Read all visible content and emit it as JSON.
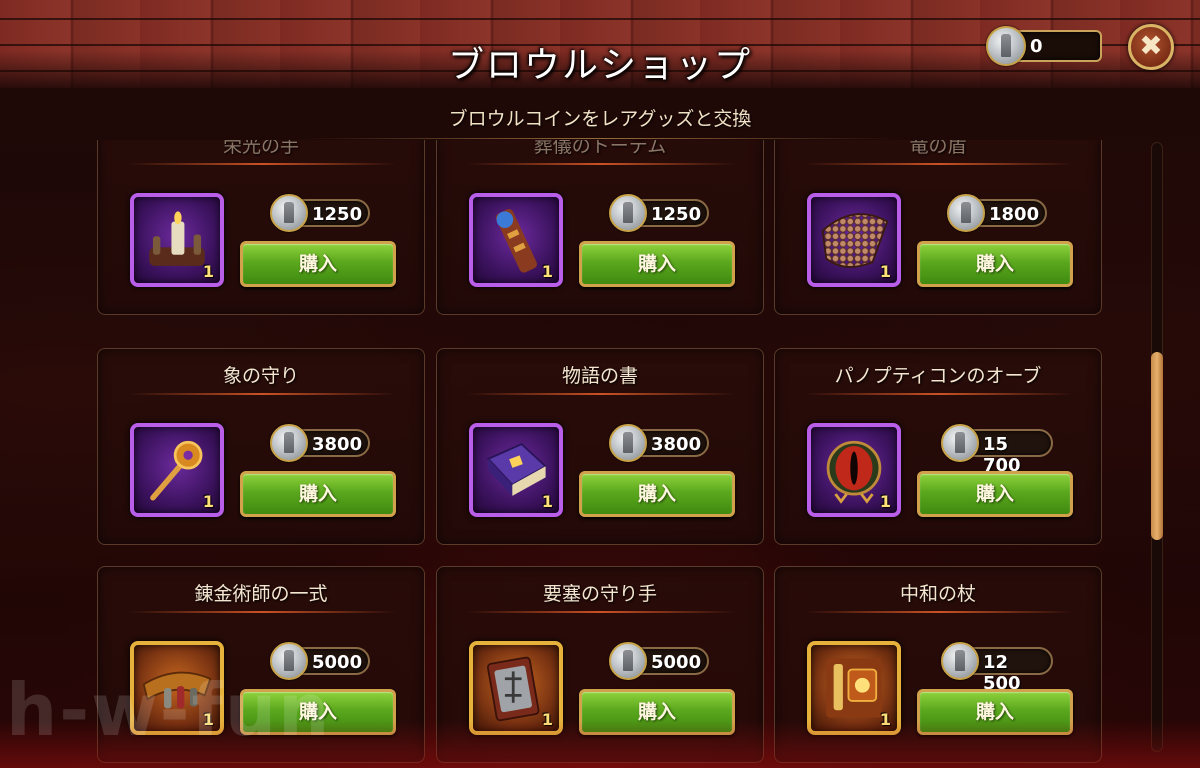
{
  "header": {
    "title": "ブロウルショップ",
    "coins": "0",
    "close_symbol": "✖"
  },
  "subtitle": "ブロウルコインをレアグッズと交換",
  "items": [
    {
      "name": "栄光の手",
      "price": "1250",
      "qty": "1",
      "buy_label": "購入",
      "frame": "purple",
      "icon": "candle-hand-icon"
    },
    {
      "name": "葬儀のトーテム",
      "price": "1250",
      "qty": "1",
      "buy_label": "購入",
      "frame": "purple",
      "icon": "totem-icon"
    },
    {
      "name": "竜の盾",
      "price": "1800",
      "qty": "1",
      "buy_label": "購入",
      "frame": "purple",
      "icon": "dragon-scale-shield-icon"
    },
    {
      "name": "象の守り",
      "price": "3800",
      "qty": "1",
      "buy_label": "購入",
      "frame": "purple",
      "icon": "amulet-icon"
    },
    {
      "name": "物語の書",
      "price": "3800",
      "qty": "1",
      "buy_label": "購入",
      "frame": "purple",
      "icon": "book-icon"
    },
    {
      "name": "パノプティコンのオーブ",
      "price": "15 700",
      "qty": "1",
      "buy_label": "購入",
      "frame": "purple",
      "icon": "eye-orb-icon"
    },
    {
      "name": "錬金術師の一式",
      "price": "5000",
      "qty": "1",
      "buy_label": "購入",
      "frame": "gold",
      "icon": "alchemy-kit-icon"
    },
    {
      "name": "要塞の守り手",
      "price": "5000",
      "qty": "1",
      "buy_label": "購入",
      "frame": "gold",
      "icon": "fortress-shield-icon"
    },
    {
      "name": "中和の杖",
      "price": "12 500",
      "qty": "1",
      "buy_label": "購入",
      "frame": "gold",
      "icon": "staff-icon"
    }
  ],
  "watermark": "h-w-fun",
  "colors": {
    "buy_green": "#5ba81e",
    "purple_frame": "#b85ee8",
    "gold_frame": "#e7b23c",
    "accent_gold": "#c9a45a"
  }
}
